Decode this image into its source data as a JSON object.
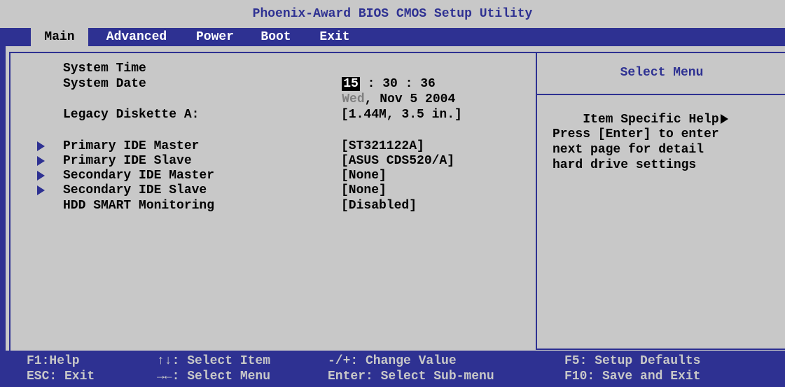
{
  "window_title": "Phoenix-Award BIOS CMOS Setup Utility",
  "menu": {
    "tabs": [
      {
        "label": "Main",
        "active": true
      },
      {
        "label": "Advanced",
        "active": false
      },
      {
        "label": "Power",
        "active": false
      },
      {
        "label": "Boot",
        "active": false
      },
      {
        "label": "Exit",
        "active": false
      }
    ]
  },
  "main": {
    "system_time": {
      "label": "System Time",
      "hour": "15",
      "rest": " : 30 : 36"
    },
    "system_date": {
      "label": "System Date",
      "day": "Wed",
      "rest": ", Nov 5 2004"
    },
    "legacy_diskette": {
      "label": "Legacy Diskette A:",
      "value": "[1.44M, 3.5 in.]"
    },
    "items": [
      {
        "label": "Primary IDE Master",
        "value": "[ST321122A]",
        "submenu": true
      },
      {
        "label": "Primary IDE Slave",
        "value": "[ASUS CDS520/A]",
        "submenu": true
      },
      {
        "label": "Secondary IDE Master",
        "value": "[None]",
        "submenu": true
      },
      {
        "label": "Secondary IDE Slave",
        "value": "[None]",
        "submenu": true
      },
      {
        "label": "HDD SMART Monitoring",
        "value": "[Disabled]",
        "submenu": false
      }
    ]
  },
  "help": {
    "title": "Select Menu",
    "item_help": "Item Specific Help",
    "lines": [
      "Press [Enter] to enter",
      "next page for detail",
      "hard drive settings"
    ]
  },
  "footer": {
    "f1": "F1:Help",
    "esc": "ESC: Exit",
    "select_item": "↑↓: Select Item",
    "select_menu": "→←: Select Menu",
    "change_value": "-/+: Change Value",
    "sub_menu": "Enter: Select Sub-menu",
    "f5": "F5: Setup Defaults",
    "f10": "F10: Save and Exit"
  },
  "colors": {
    "bios_blue": "#2e3192",
    "panel_gray": "#c8c8c8"
  }
}
